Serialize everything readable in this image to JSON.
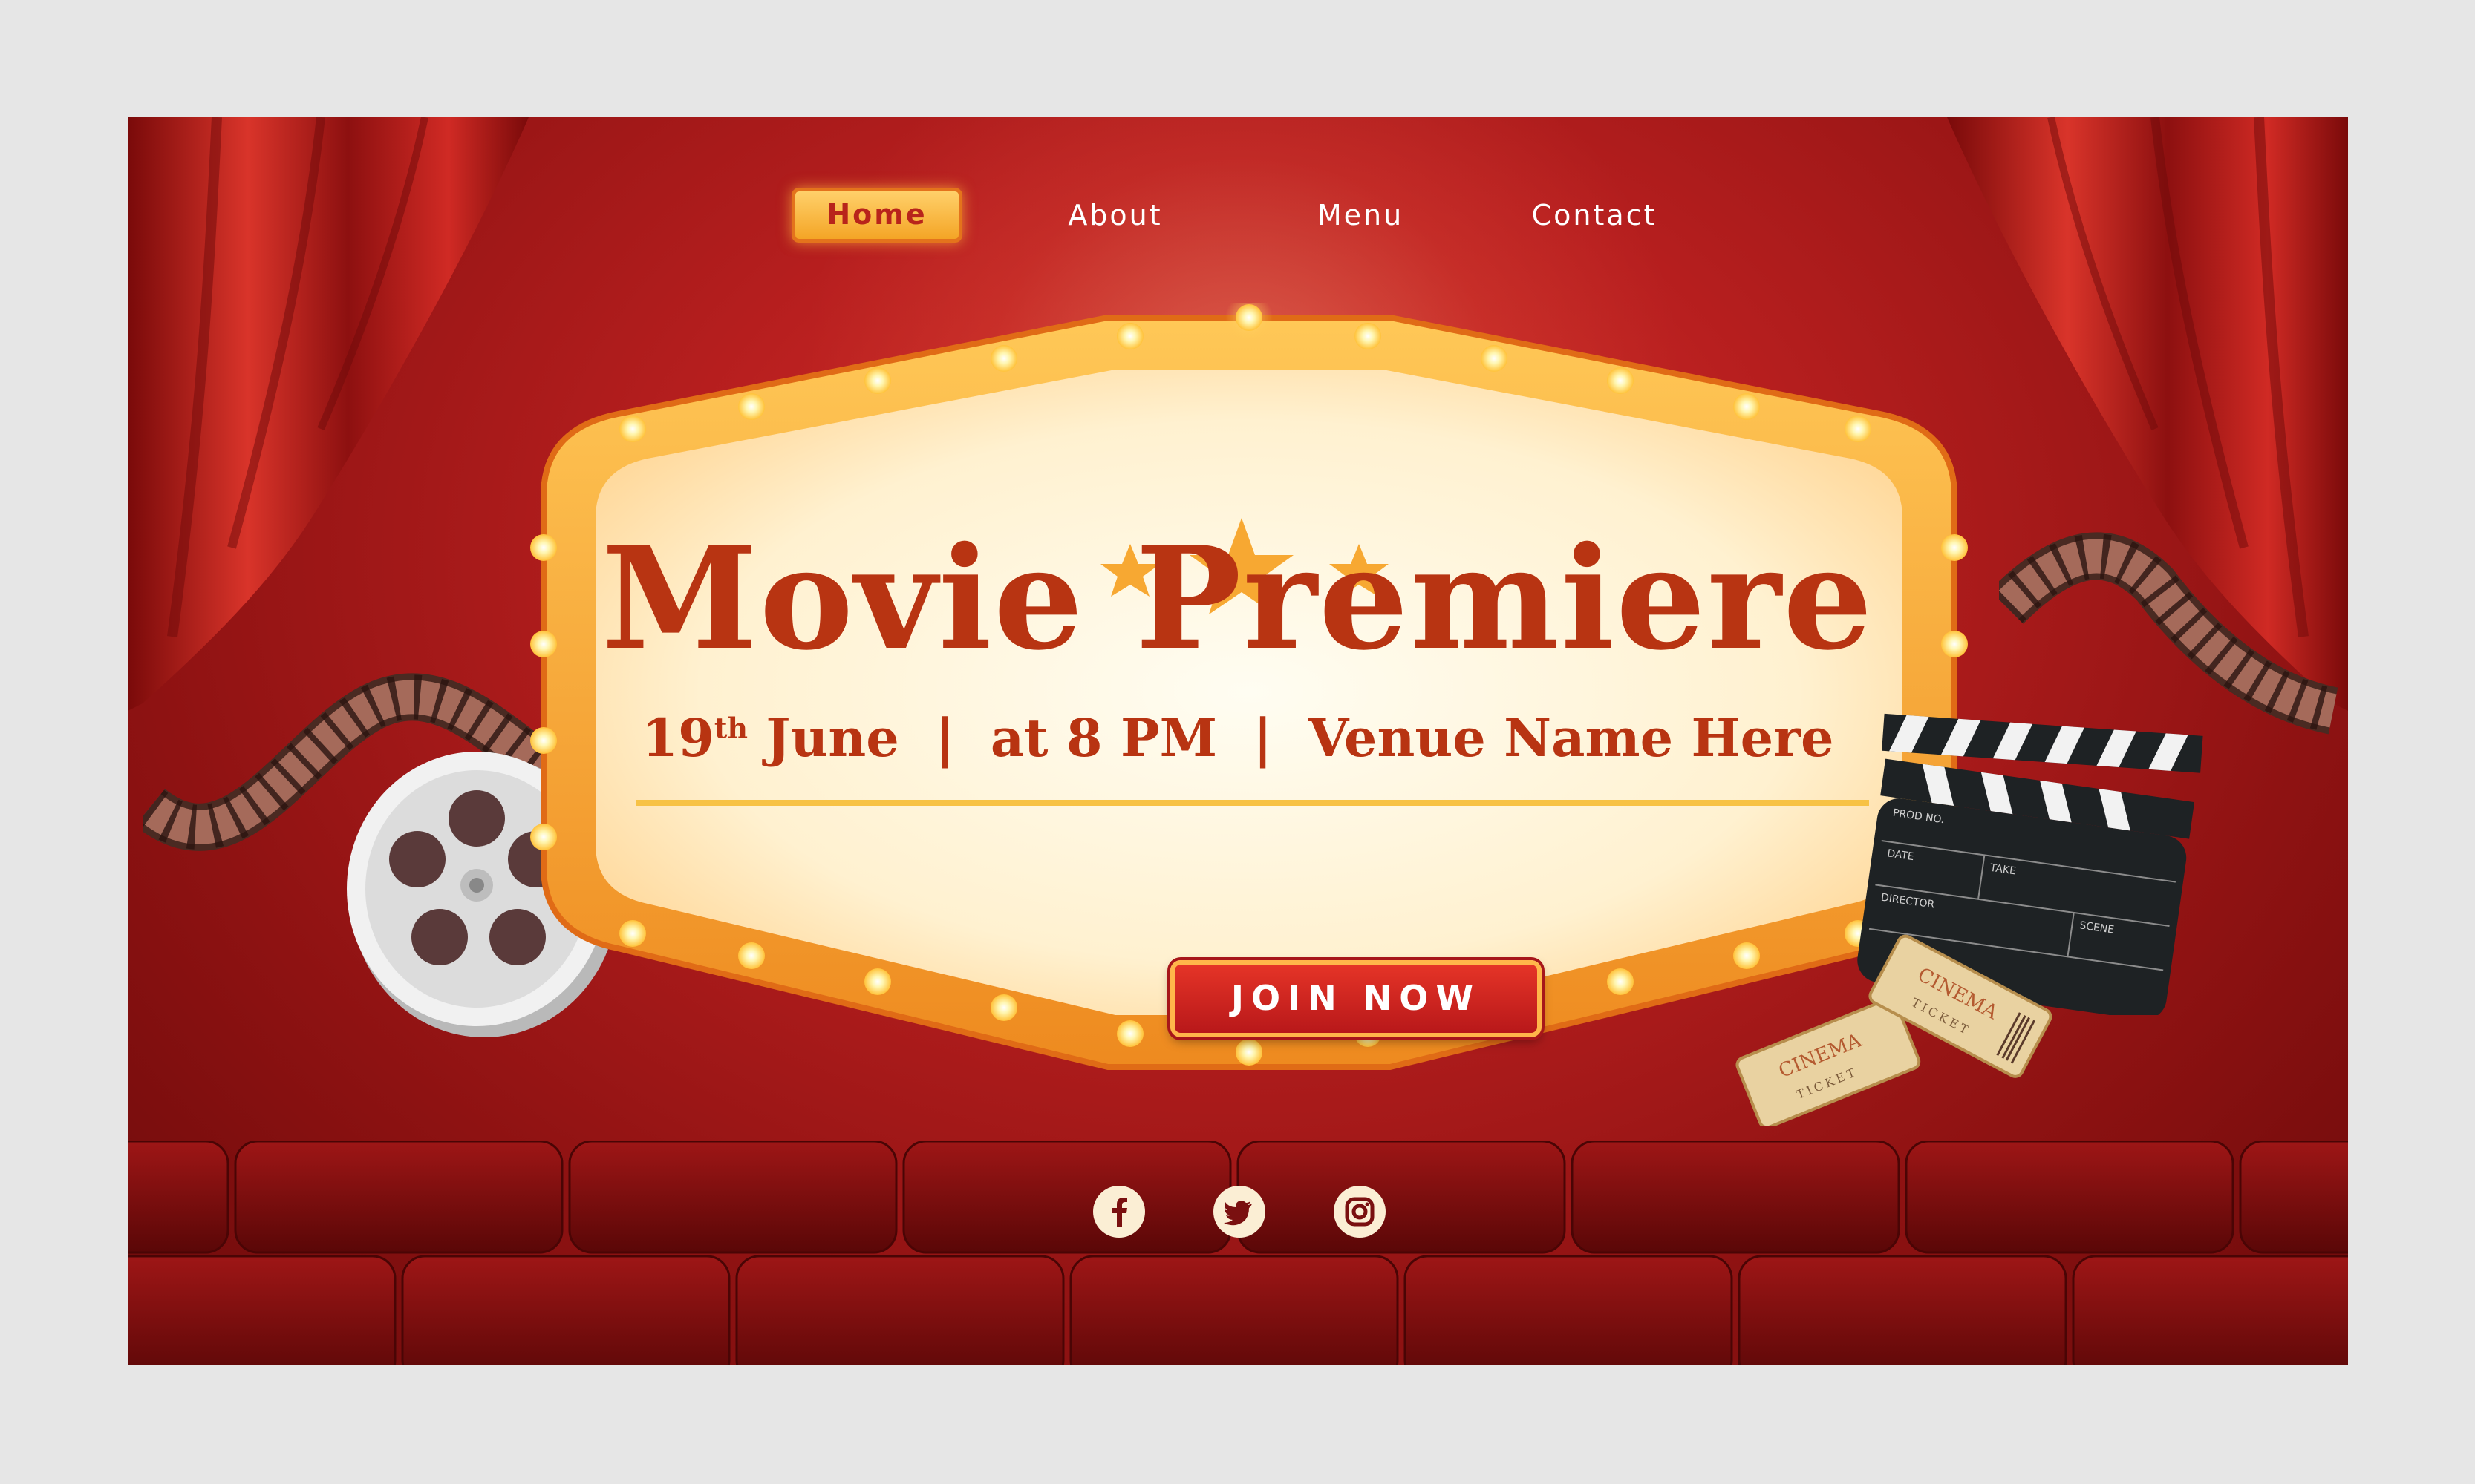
{
  "nav": {
    "items": [
      {
        "label": "Home",
        "active": true
      },
      {
        "label": "About"
      },
      {
        "label": "Menu"
      },
      {
        "label": "Contact"
      }
    ]
  },
  "hero": {
    "title": "Movie Premiere",
    "date_day": "19",
    "date_suffix": "th",
    "date_month": "June",
    "separator": "|",
    "time": "at 8 PM",
    "venue": "Venue Name Here",
    "cta_label": "JOIN NOW"
  },
  "clapperboard": {
    "labels": [
      "PROD NO.",
      "DATE",
      "TAKE",
      "DIRECTOR",
      "SCENE"
    ]
  },
  "tickets": [
    {
      "line1": "CINEMA",
      "line2": "TICKET"
    },
    {
      "line1": "CINEMA",
      "line2": "TICKET"
    }
  ],
  "social": {
    "icons": [
      "facebook-icon",
      "twitter-icon",
      "instagram-icon"
    ]
  },
  "colors": {
    "background": "#b81f1f",
    "accent_gold": "#f4a526",
    "title_color": "#b83412",
    "sign_fill": "#fff3d6",
    "button_red": "#d42521"
  }
}
